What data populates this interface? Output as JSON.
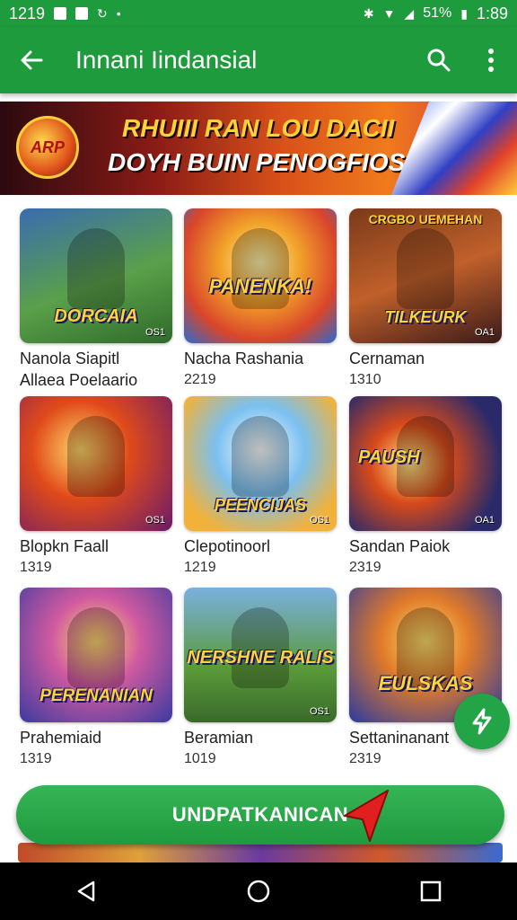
{
  "status_bar": {
    "time_left": "1219",
    "battery": "51%",
    "time_right": "1:89"
  },
  "app_bar": {
    "title": "Innani Iindansial",
    "icons": [
      "back-arrow-icon",
      "search-icon",
      "more-vert-icon"
    ]
  },
  "banner": {
    "logo_text": "ARP",
    "line1": "RHUIII RAN LOU DACII",
    "line2": "DOYH BUIN PENOGFIOS"
  },
  "games": [
    {
      "thumb_top": "",
      "thumb_label": "DORCAIA",
      "rating": "OS1",
      "name_line1": "Nanola Siapitl",
      "name_line2": "Allaea Poelaario",
      "count": ""
    },
    {
      "thumb_top": "",
      "thumb_label": "PANENKA!",
      "rating": "",
      "name_line1": "Nacha Rashania",
      "name_line2": "",
      "count": "2219"
    },
    {
      "thumb_top": "CRGBO UEMEHAN",
      "thumb_label": "TILKEURK",
      "rating": "OA1",
      "name_line1": "Cernaman",
      "name_line2": "",
      "count": "1310"
    },
    {
      "thumb_top": "",
      "thumb_label": "",
      "rating": "OS1",
      "name_line1": "Blopkn Faall",
      "name_line2": "",
      "count": "1319"
    },
    {
      "thumb_top": "",
      "thumb_label": "PEENCIJAS",
      "rating": "OS1",
      "name_line1": "Clepotinoorl",
      "name_line2": "",
      "count": "1219"
    },
    {
      "thumb_top": "",
      "thumb_label": "PAUSH",
      "rating": "OA1",
      "name_line1": "Sandan Paiok",
      "name_line2": "",
      "count": "2319"
    },
    {
      "thumb_top": "",
      "thumb_label": "PERENANIAN",
      "rating": "",
      "name_line1": "Prahemiaid",
      "name_line2": "",
      "count": "1319"
    },
    {
      "thumb_top": "",
      "thumb_label": "NERSHNE RALIS",
      "rating": "OS1",
      "name_line1": "Beramian",
      "name_line2": "",
      "count": "1019"
    },
    {
      "thumb_top": "",
      "thumb_label": "EULSKAS",
      "rating": "",
      "name_line1": "Settaninanant",
      "name_line2": "",
      "count": "2319"
    }
  ],
  "cta": {
    "label": "UNDPATKANICAN"
  },
  "nav": {
    "icons": [
      "back-triangle-icon",
      "home-circle-icon",
      "recents-square-icon"
    ]
  },
  "colors": {
    "primary_green": "#1e9b3c",
    "cta_green": "#2aa84a",
    "nav_black": "#000000"
  }
}
